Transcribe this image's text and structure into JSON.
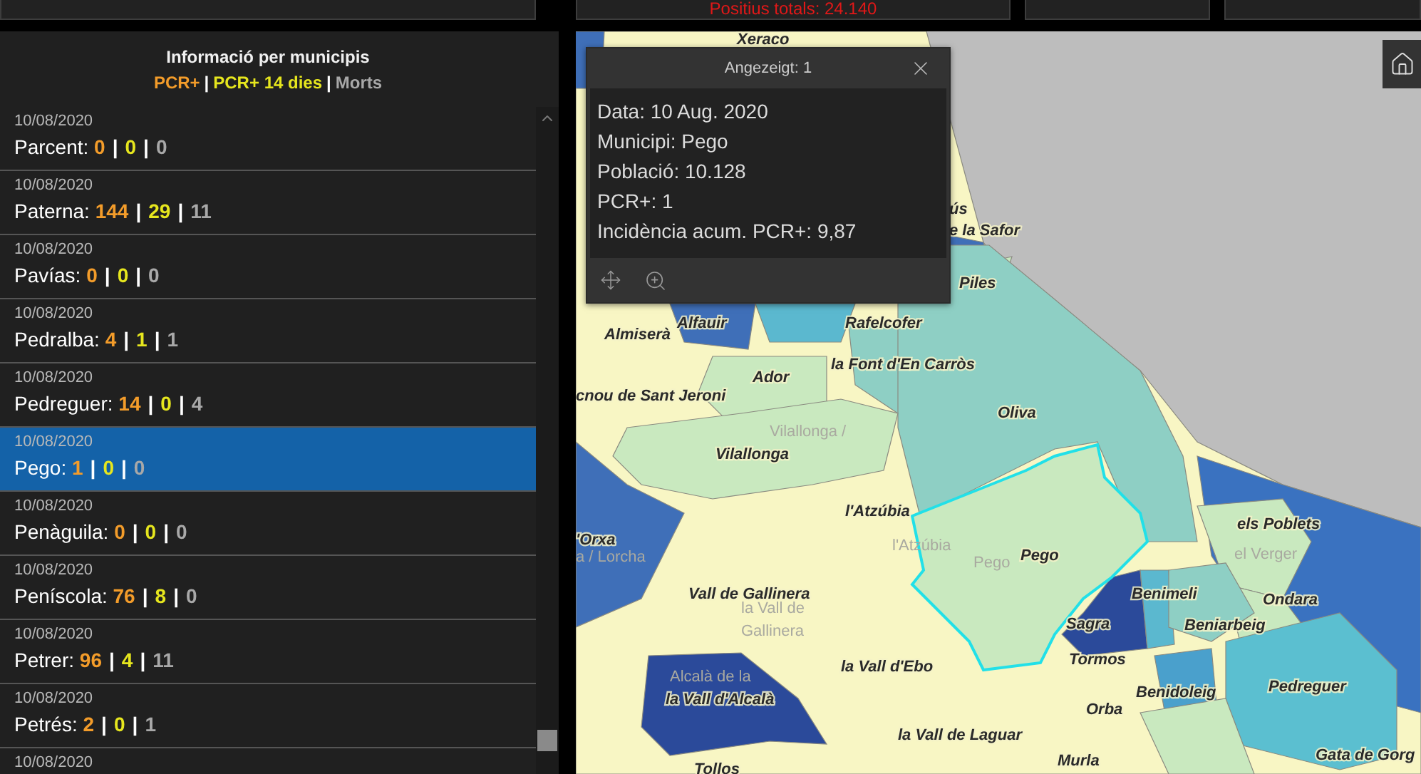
{
  "top_bar": {
    "total_positives": "Positius totals: 24.140"
  },
  "sidebar": {
    "title": "Informació per municipis",
    "legend": [
      {
        "label": "PCR+",
        "color": "#f39c2a"
      },
      {
        "label": "PCR+ 14 dies",
        "color": "#e6e61e"
      },
      {
        "label": "Morts",
        "color": "#a8a8a8"
      }
    ],
    "separator": "|",
    "items": [
      {
        "date": "10/08/2020",
        "name": "Parcent:",
        "values": [
          "0",
          "0",
          "0"
        ],
        "selected": false
      },
      {
        "date": "10/08/2020",
        "name": "Paterna:",
        "values": [
          "144",
          "29",
          "11"
        ],
        "selected": false
      },
      {
        "date": "10/08/2020",
        "name": "Pavías:",
        "values": [
          "0",
          "0",
          "0"
        ],
        "selected": false
      },
      {
        "date": "10/08/2020",
        "name": "Pedralba:",
        "values": [
          "4",
          "1",
          "1"
        ],
        "selected": false
      },
      {
        "date": "10/08/2020",
        "name": "Pedreguer:",
        "values": [
          "14",
          "0",
          "4"
        ],
        "selected": false
      },
      {
        "date": "10/08/2020",
        "name": "Pego:",
        "values": [
          "1",
          "0",
          "0"
        ],
        "selected": true
      },
      {
        "date": "10/08/2020",
        "name": "Penàguila:",
        "values": [
          "0",
          "0",
          "0"
        ],
        "selected": false
      },
      {
        "date": "10/08/2020",
        "name": "Peníscola:",
        "values": [
          "76",
          "8",
          "0"
        ],
        "selected": false
      },
      {
        "date": "10/08/2020",
        "name": "Petrer:",
        "values": [
          "96",
          "4",
          "11"
        ],
        "selected": false
      },
      {
        "date": "10/08/2020",
        "name": "Petrés:",
        "values": [
          "2",
          "0",
          "1"
        ],
        "selected": false
      },
      {
        "date": "10/08/2020",
        "selected": false
      }
    ]
  },
  "popup": {
    "title": "Angezeigt: 1",
    "lines": [
      "Data: 10 Aug. 2020",
      "Municipi: Pego",
      "Població: 10.128",
      "PCR+: 1",
      "Incidència acum. PCR+: 9,87"
    ]
  },
  "map": {
    "labels": [
      {
        "text": "Xeraco",
        "kind": "bold"
      },
      {
        "text": "ús",
        "kind": "bold"
      },
      {
        "text": "e la Safor",
        "kind": "bold"
      },
      {
        "text": "Piles",
        "kind": "bold"
      },
      {
        "text": "Rafelcofer",
        "kind": "bold"
      },
      {
        "text": "Almiserà",
        "kind": "bold"
      },
      {
        "text": "Alfauir",
        "kind": "bold"
      },
      {
        "text": "la Font d'En Carròs",
        "kind": "bold"
      },
      {
        "text": "Oliva",
        "kind": "bold"
      },
      {
        "text": "Ador",
        "kind": "bold"
      },
      {
        "text": "cnou de Sant Jeroni",
        "kind": "bold"
      },
      {
        "text": "Vilallonga",
        "kind": "bold"
      },
      {
        "text": "l'Atzúbia",
        "kind": "bold"
      },
      {
        "text": "'Orxa",
        "kind": "bold"
      },
      {
        "text": "Pego",
        "kind": "bold"
      },
      {
        "text": "els Poblets",
        "kind": "bold"
      },
      {
        "text": "Benimeli",
        "kind": "bold"
      },
      {
        "text": "Ondara",
        "kind": "bold"
      },
      {
        "text": "Sagra",
        "kind": "bold"
      },
      {
        "text": "Beniarbeig",
        "kind": "bold"
      },
      {
        "text": "Vall de Gallinera",
        "kind": "bold"
      },
      {
        "text": "Tormos",
        "kind": "bold"
      },
      {
        "text": "la Vall d'Ebo",
        "kind": "bold"
      },
      {
        "text": "Benidoleig",
        "kind": "bold"
      },
      {
        "text": "Pedreguer",
        "kind": "bold"
      },
      {
        "text": "la Vall d'Alcalà",
        "kind": "bold"
      },
      {
        "text": "Orba",
        "kind": "bold"
      },
      {
        "text": "la Vall de Laguar",
        "kind": "bold"
      },
      {
        "text": "Murla",
        "kind": "bold"
      },
      {
        "text": "Tollos",
        "kind": "bold"
      },
      {
        "text": "Gata de Gorg",
        "kind": "bold"
      },
      {
        "text": "Vilallonga /",
        "kind": "faint"
      },
      {
        "text": "a / Lorcha",
        "kind": "faint"
      },
      {
        "text": "Pego",
        "kind": "faint"
      },
      {
        "text": "l'Atzúbia",
        "kind": "faint"
      },
      {
        "text": "la Vall de",
        "kind": "faint"
      },
      {
        "text": "Gallinera",
        "kind": "faint"
      },
      {
        "text": "el Verger",
        "kind": "faint"
      },
      {
        "text": "Alcalà de la",
        "kind": "faint"
      }
    ]
  }
}
